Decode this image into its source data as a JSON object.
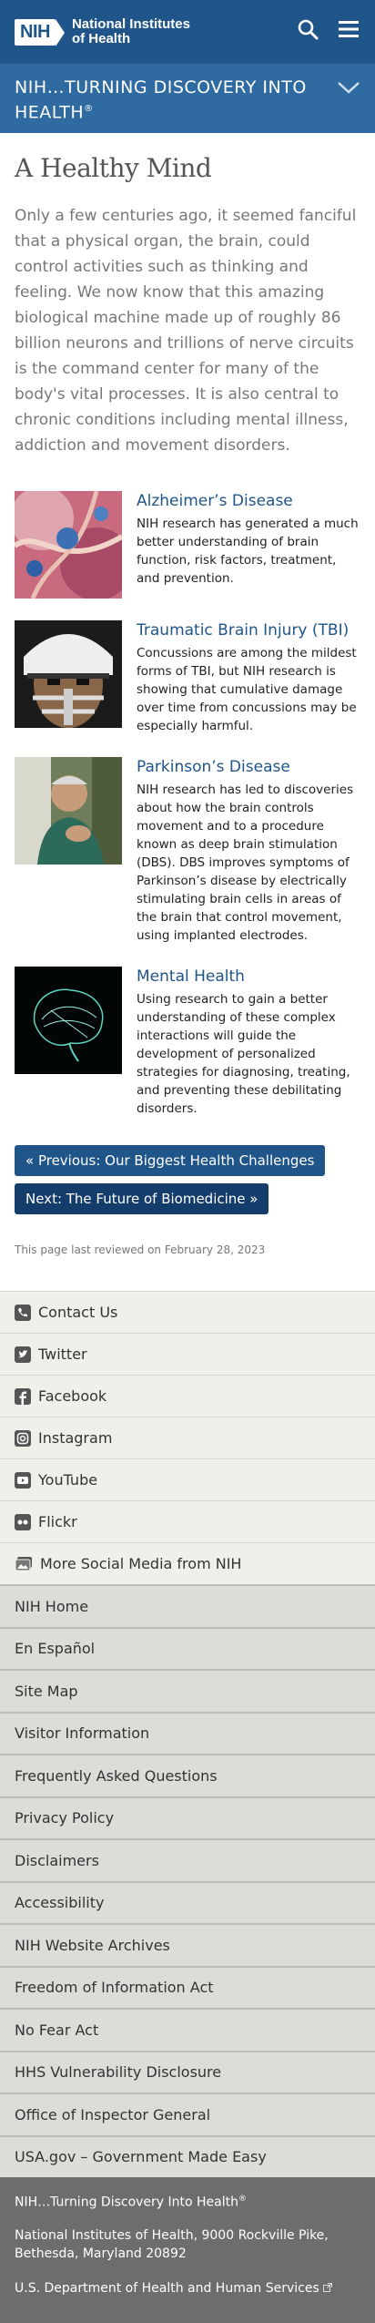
{
  "header": {
    "logo_abbr": "NIH",
    "logo_line1": "National Institutes",
    "logo_line2": "of Health",
    "subtitle": "NIH…TURNING DISCOVERY INTO HEALTH",
    "subtitle_mark": "®"
  },
  "main": {
    "title": "A Healthy Mind",
    "intro": "Only a few centuries ago, it seemed fanciful that a physical organ, the brain, could control activities such as thinking and feeling. We now know that this amazing biological machine made up of roughly 86 billion neurons and trillions of nerve circuits is the command center for many of the body's vital processes.  It is also central to chronic conditions including mental illness, addiction and movement disorders.",
    "topics": [
      {
        "title": "Alzheimer’s Disease",
        "text": "NIH research has generated a much better understanding of brain function, risk factors, treatment, and prevention."
      },
      {
        "title": "Traumatic Brain Injury (TBI)",
        "text": "Concussions are among the mildest forms of TBI, but NIH research is showing that cumulative damage over time from concussions may be especially harmful."
      },
      {
        "title": "Parkinson’s Disease",
        "text": "NIH research has led to discoveries about how the brain controls movement and to a procedure known as deep brain stimulation (DBS). DBS improves symptoms of Parkinson’s disease by electrically stimulating brain cells in areas of the brain that control movement, using implanted electrodes."
      },
      {
        "title": "Mental Health",
        "text": "Using research to gain a better understanding of these complex interactions will guide the development of personalized strategies for diagnosing, treating, and preventing these debilitating disorders."
      }
    ],
    "prev_label": "« Previous: Our Biggest Health Challenges",
    "next_label": "Next: The Future of Biomedicine »",
    "reviewed": "This page last reviewed on February 28, 2023"
  },
  "social": [
    {
      "label": "Contact Us",
      "icon": "phone-icon"
    },
    {
      "label": "Twitter",
      "icon": "twitter-icon"
    },
    {
      "label": "Facebook",
      "icon": "facebook-icon"
    },
    {
      "label": "Instagram",
      "icon": "instagram-icon"
    },
    {
      "label": "YouTube",
      "icon": "youtube-icon"
    },
    {
      "label": "Flickr",
      "icon": "flickr-icon"
    },
    {
      "label": "More Social Media from NIH",
      "icon": "images-icon"
    }
  ],
  "links": [
    "NIH Home",
    "En Español",
    "Site Map",
    "Visitor Information",
    "Frequently Asked Questions",
    "Privacy Policy",
    "Disclaimers",
    "Accessibility",
    "NIH Website Archives",
    "Freedom of Information Act",
    "No Fear Act",
    "HHS Vulnerability Disclosure",
    "Office of Inspector General",
    "USA.gov – Government Made Easy"
  ],
  "footer": {
    "tagline": "NIH…Turning Discovery Into Health",
    "tagline_mark": "®",
    "address": "National Institutes of Health, 9000 Rockville Pike, Bethesda, Maryland 20892",
    "hhs": "U.S. Department of Health and Human Services"
  },
  "colors": {
    "header_bg": "#20558a",
    "subheader_bg": "#2f6aa1",
    "link": "#20558a"
  }
}
